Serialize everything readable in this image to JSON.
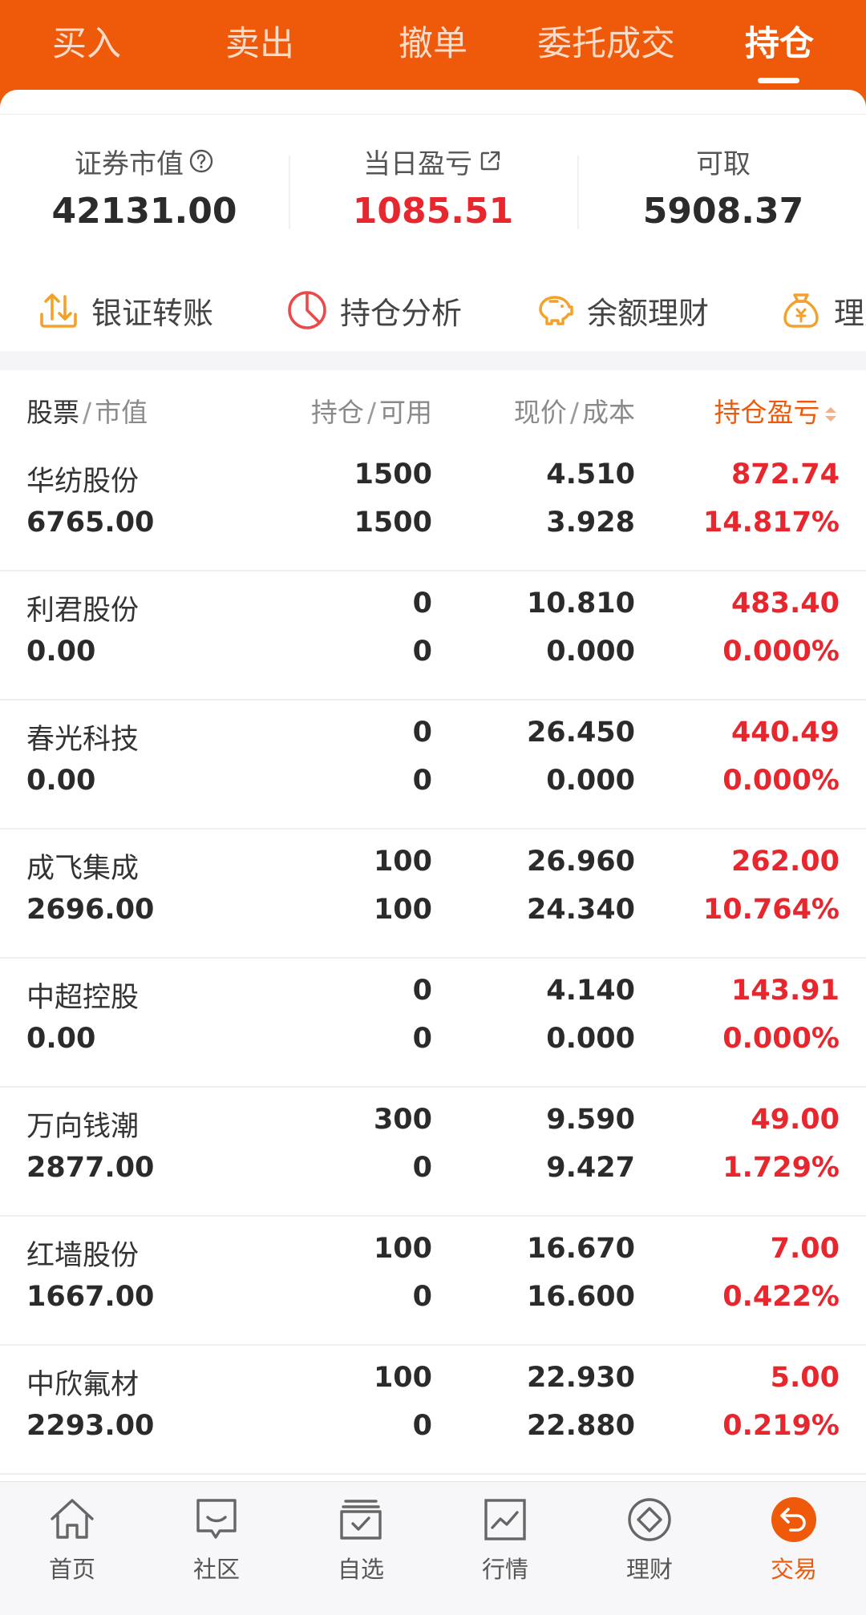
{
  "tabs": [
    {
      "label": "买入",
      "active": false
    },
    {
      "label": "卖出",
      "active": false
    },
    {
      "label": "撤单",
      "active": false
    },
    {
      "label": "委托成交",
      "active": false
    },
    {
      "label": "持仓",
      "active": true
    }
  ],
  "summary": {
    "market_value_label": "证券市值",
    "market_value": "42131.00",
    "daily_pnl_label": "当日盈亏",
    "daily_pnl": "1085.51",
    "withdrawable_label": "可取",
    "withdrawable": "5908.37"
  },
  "shortcuts": [
    {
      "label": "银证转账",
      "icon": "transfer-icon"
    },
    {
      "label": "持仓分析",
      "icon": "pie-chart-icon"
    },
    {
      "label": "余额理财",
      "icon": "piggy-bank-icon"
    },
    {
      "label": "理财",
      "icon": "money-bag-icon"
    }
  ],
  "table": {
    "headers": {
      "col1_main": "股票",
      "col1_sub": "市值",
      "col2_main": "持仓",
      "col2_sub": "可用",
      "col3_main": "现价",
      "col3_sub": "成本",
      "col4_main": "持仓盈亏"
    },
    "rows": [
      {
        "name": "华纺股份",
        "market_value": "6765.00",
        "position": "1500",
        "available": "1500",
        "price": "4.510",
        "cost": "3.928",
        "pnl": "872.74",
        "pnl_pct": "14.817%"
      },
      {
        "name": "利君股份",
        "market_value": "0.00",
        "position": "0",
        "available": "0",
        "price": "10.810",
        "cost": "0.000",
        "pnl": "483.40",
        "pnl_pct": "0.000%"
      },
      {
        "name": "春光科技",
        "market_value": "0.00",
        "position": "0",
        "available": "0",
        "price": "26.450",
        "cost": "0.000",
        "pnl": "440.49",
        "pnl_pct": "0.000%"
      },
      {
        "name": "成飞集成",
        "market_value": "2696.00",
        "position": "100",
        "available": "100",
        "price": "26.960",
        "cost": "24.340",
        "pnl": "262.00",
        "pnl_pct": "10.764%"
      },
      {
        "name": "中超控股",
        "market_value": "0.00",
        "position": "0",
        "available": "0",
        "price": "4.140",
        "cost": "0.000",
        "pnl": "143.91",
        "pnl_pct": "0.000%"
      },
      {
        "name": "万向钱潮",
        "market_value": "2877.00",
        "position": "300",
        "available": "0",
        "price": "9.590",
        "cost": "9.427",
        "pnl": "49.00",
        "pnl_pct": "1.729%"
      },
      {
        "name": "红墙股份",
        "market_value": "1667.00",
        "position": "100",
        "available": "0",
        "price": "16.670",
        "cost": "16.600",
        "pnl": "7.00",
        "pnl_pct": "0.422%"
      },
      {
        "name": "中欣氟材",
        "market_value": "2293.00",
        "position": "100",
        "available": "0",
        "price": "22.930",
        "cost": "22.880",
        "pnl": "5.00",
        "pnl_pct": "0.219%"
      }
    ]
  },
  "bottom_nav": [
    {
      "label": "首页",
      "icon": "home-icon",
      "active": false
    },
    {
      "label": "社区",
      "icon": "chat-icon",
      "active": false
    },
    {
      "label": "自选",
      "icon": "watchlist-icon",
      "active": false
    },
    {
      "label": "行情",
      "icon": "market-chart-icon",
      "active": false
    },
    {
      "label": "理财",
      "icon": "finance-diamond-icon",
      "active": false
    },
    {
      "label": "交易",
      "icon": "trade-icon",
      "active": true
    }
  ],
  "colors": {
    "accent": "#ee5a0a",
    "profit_red": "#e8262d",
    "shortcut_orange": "#f3a12b",
    "analysis_red": "#ea4a4a"
  }
}
